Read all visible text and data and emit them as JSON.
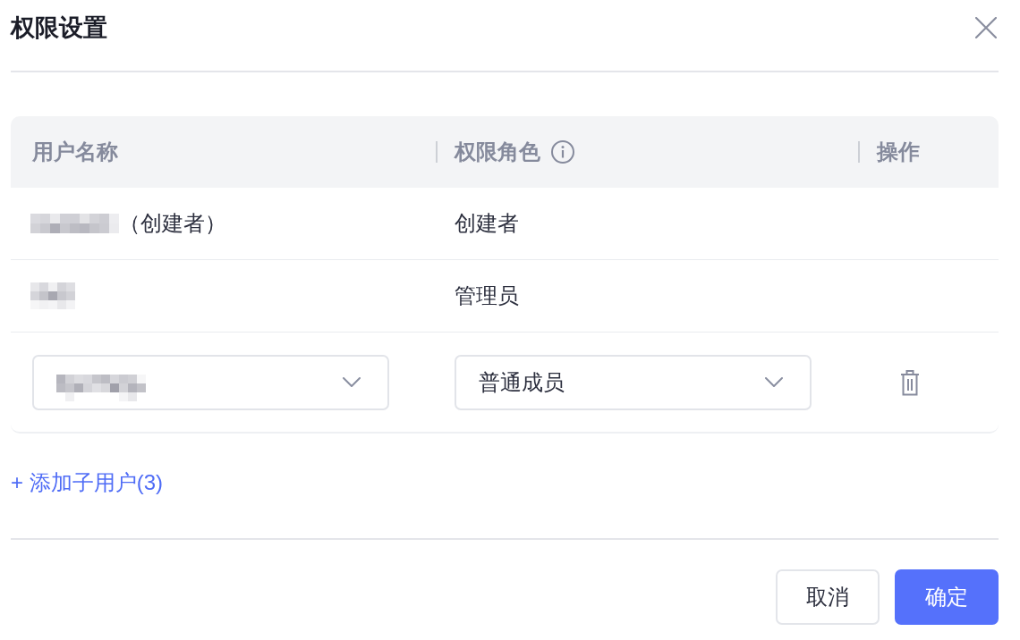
{
  "dialog": {
    "title": "权限设置"
  },
  "table": {
    "columns": [
      {
        "label": "用户名称",
        "info": false
      },
      {
        "label": "权限角色",
        "info": true
      },
      {
        "label": "操作",
        "info": false
      }
    ],
    "rows": [
      {
        "kind": "static",
        "name_note": "（创建者）",
        "role": "创建者"
      },
      {
        "kind": "static",
        "role": "管理员"
      },
      {
        "kind": "edit",
        "role": "普通成员"
      }
    ]
  },
  "add_link": "+ 添加子用户(3)",
  "buttons": [
    {
      "label": "取消",
      "kind": "secondary"
    },
    {
      "label": "确定",
      "kind": "primary"
    }
  ]
}
